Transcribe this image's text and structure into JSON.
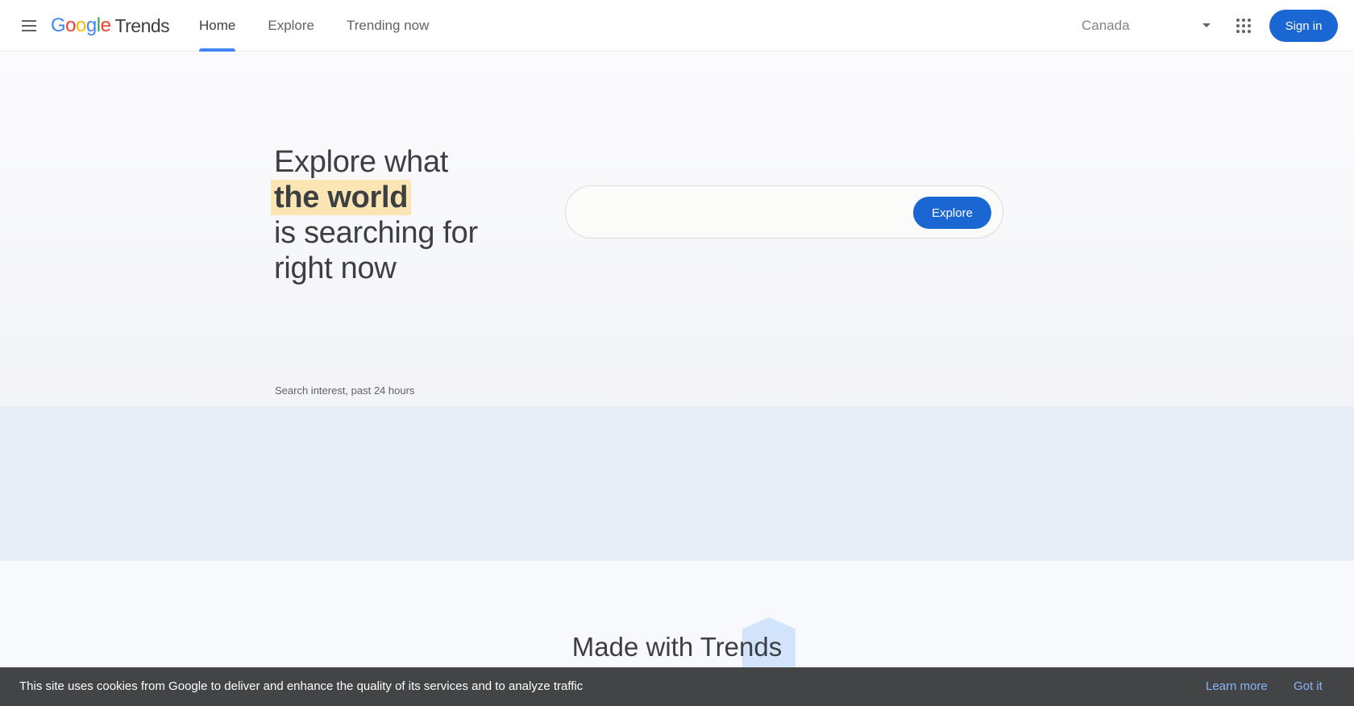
{
  "header": {
    "menu_icon": "hamburger-menu-icon",
    "logo": {
      "google_letters": [
        {
          "char": "G",
          "color": "#4285f4"
        },
        {
          "char": "o",
          "color": "#ea4335"
        },
        {
          "char": "o",
          "color": "#fbbc05"
        },
        {
          "char": "g",
          "color": "#4285f4"
        },
        {
          "char": "l",
          "color": "#34a853"
        },
        {
          "char": "e",
          "color": "#ea4335"
        }
      ],
      "product": "Trends"
    },
    "nav": {
      "home": "Home",
      "explore": "Explore",
      "trending_now": "Trending now"
    },
    "region": "Canada",
    "region_icon": "dropdown-arrow-icon",
    "apps_icon": "google-apps-grid-icon",
    "sign_in": "Sign in",
    "accent_color": "#1a66d2"
  },
  "hero": {
    "line1": "Explore what",
    "line2_highlight": "the world",
    "line3": "is searching for",
    "line4": "right now",
    "search": {
      "value": "",
      "button": "Explore"
    },
    "interest_caption": "Search interest, past 24 hours"
  },
  "made_with": {
    "title": "Made with Trends"
  },
  "cookie_bar": {
    "text": "This site uses cookies from Google to deliver and enhance the quality of its services and to analyze traffic",
    "learn_more": "Learn more",
    "got_it": "Got it"
  }
}
